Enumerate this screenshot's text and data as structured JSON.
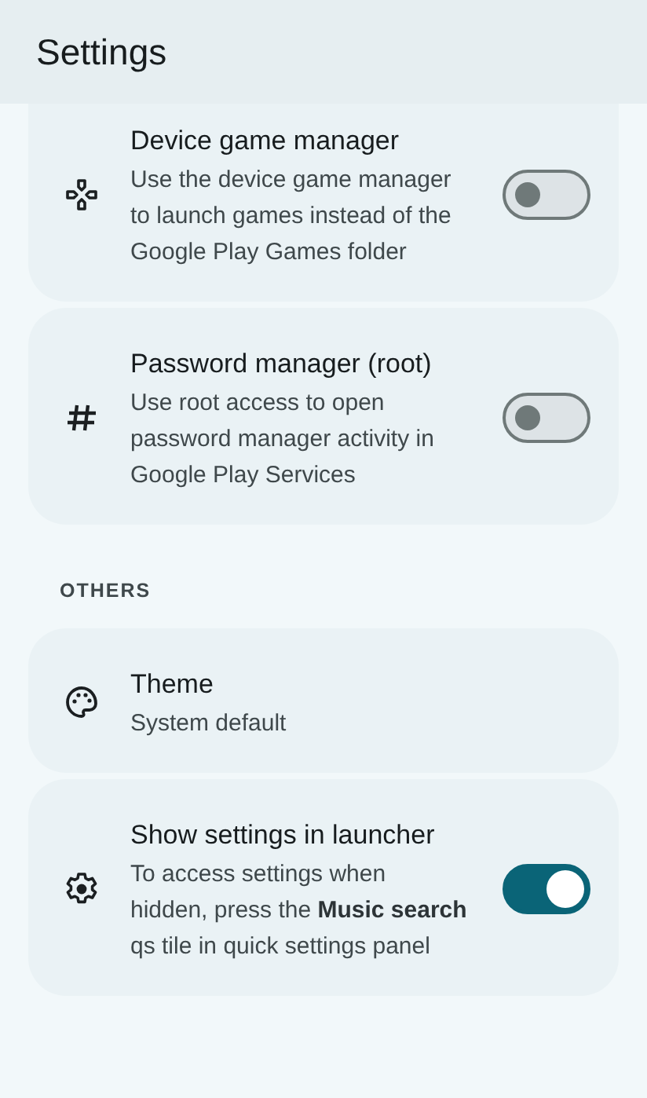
{
  "app_bar": {
    "title": "Settings"
  },
  "sections": [
    {
      "items": [
        {
          "kind": "toggle",
          "title": "Device game manager",
          "description": "Use the device game manager to launch games instead of the Google Play Games folder",
          "on": false
        },
        {
          "kind": "toggle",
          "title": "Password manager (root)",
          "description": "Use root access to open password manager activity in Google Play Services",
          "on": false
        }
      ]
    },
    {
      "title": "OTHERS",
      "items": [
        {
          "kind": "value",
          "title": "Theme",
          "description": "System default"
        },
        {
          "kind": "toggle",
          "title": "Show settings in launcher",
          "description": "To access settings when hidden, press the **Music search** qs tile in quick settings panel",
          "on": true
        }
      ]
    }
  ]
}
